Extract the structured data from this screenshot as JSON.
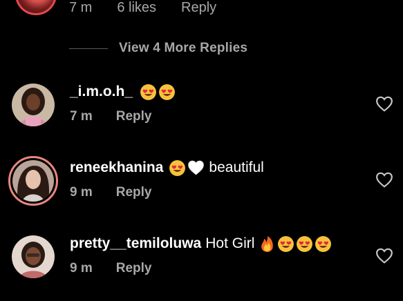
{
  "top_comment": {
    "time": "7 m",
    "likes": "6 likes",
    "reply_label": "Reply"
  },
  "view_more": {
    "label": "View 4 More Replies"
  },
  "comments": [
    {
      "username": "_i.m.o.h_",
      "text": "",
      "emojis": [
        "heart-eyes-icon",
        "heart-eyes-icon"
      ],
      "time": "7 m",
      "reply_label": "Reply"
    },
    {
      "username": "reneekhanina",
      "text": "beautiful",
      "emojis": [
        "heart-eyes-icon",
        "white-heart-icon"
      ],
      "time": "9 m",
      "reply_label": "Reply"
    },
    {
      "username": "pretty__temiloluwa",
      "text": "Hot Girl",
      "emojis": [
        "fire-icon",
        "heart-eyes-icon",
        "heart-eyes-icon",
        "heart-eyes-icon"
      ],
      "time": "9 m",
      "reply_label": "Reply"
    }
  ],
  "colors": {
    "background": "#000000",
    "text_primary": "#ffffff",
    "text_secondary": "#a8a8a8",
    "story_ring": "#e9877d"
  }
}
